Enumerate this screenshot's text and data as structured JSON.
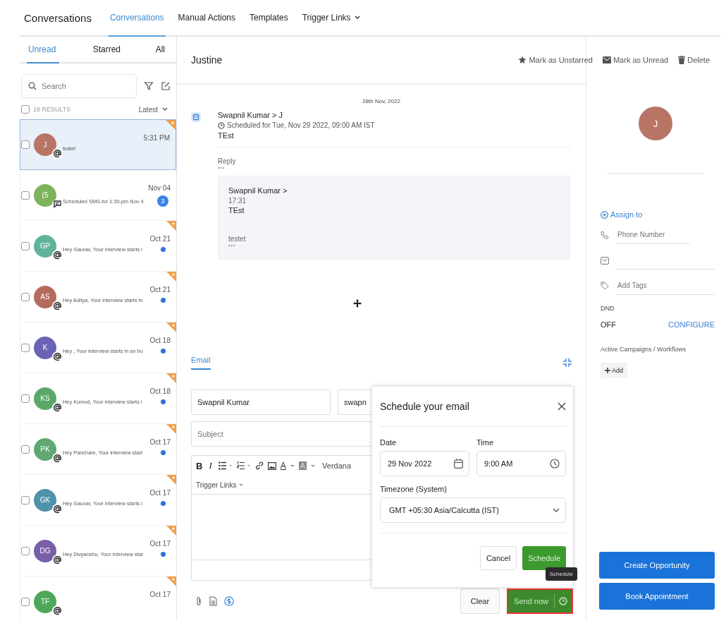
{
  "header": {
    "title": "Conversations",
    "tabs": [
      {
        "label": "Conversations",
        "selected": true,
        "dropdown": false
      },
      {
        "label": "Manual Actions",
        "selected": false,
        "dropdown": false
      },
      {
        "label": "Templates",
        "selected": false,
        "dropdown": false
      },
      {
        "label": "Trigger Links",
        "selected": false,
        "dropdown": true
      }
    ]
  },
  "inbox": {
    "tabs": [
      {
        "label": "Unread",
        "selected": true
      },
      {
        "label": "Starred",
        "selected": false
      },
      {
        "label": "All",
        "selected": false
      }
    ],
    "search": {
      "placeholder": "Search"
    },
    "select_all": {
      "checked": false
    },
    "results": "19 RESULTS",
    "sort": "Latest",
    "conversations": [
      {
        "initials": "J",
        "color": "#b87565",
        "kind": "email",
        "preview": "testet",
        "time": "5:31 PM",
        "selected": true,
        "starred": true,
        "unread": false,
        "checked": false
      },
      {
        "initials": "(5",
        "color": "#7db35a",
        "kind": "sms",
        "preview": "Scheduled SMS-for 1:30-pm Nov 4",
        "time": "Nov 04",
        "badge": "3",
        "selected": false,
        "starred": false,
        "checked": false
      },
      {
        "initials": "GP",
        "color": "#5fb39a",
        "kind": "email",
        "preview": "Hey Gaurav, Your interview starts i",
        "time": "Oct 21",
        "selected": false,
        "starred": true,
        "unread": true,
        "checked": false
      },
      {
        "initials": "AS",
        "color": "#b56a5c",
        "kind": "email",
        "preview": "Hey Aditya, Your interview starts in",
        "time": "Oct 21",
        "selected": false,
        "starred": true,
        "unread": true,
        "checked": false
      },
      {
        "initials": "K",
        "color": "#6b63b5",
        "kind": "email",
        "preview": "Hey , Your interview starts in an ho",
        "time": "Oct 18",
        "selected": false,
        "starred": true,
        "unread": true,
        "checked": false
      },
      {
        "initials": "KS",
        "color": "#5ba86b",
        "kind": "email",
        "preview": "Hey Kumud, Your interview starts i",
        "time": "Oct 18",
        "selected": false,
        "starred": true,
        "unread": true,
        "checked": false
      },
      {
        "initials": "PK",
        "color": "#5fa872",
        "kind": "email",
        "preview": "Hey Pancham, Your interview start",
        "time": "Oct 17",
        "selected": false,
        "starred": true,
        "unread": true,
        "checked": false
      },
      {
        "initials": "GK",
        "color": "#4e93a8",
        "kind": "email",
        "preview": "Hey Gaurav, Your interview starts i",
        "time": "Oct 17",
        "selected": false,
        "starred": true,
        "unread": true,
        "checked": false
      },
      {
        "initials": "DG",
        "color": "#7a5fa8",
        "kind": "email",
        "preview": "Hey Divyanshu, Your interview star",
        "time": "Oct 17",
        "selected": false,
        "starred": true,
        "unread": true,
        "checked": false
      },
      {
        "initials": "TF",
        "color": "#4ea85c",
        "kind": "email",
        "time": "Oct 17",
        "selected": false,
        "starred": true,
        "unread": false,
        "checked": false
      }
    ]
  },
  "conversation": {
    "title": "Justine",
    "actions": [
      {
        "kind": "star",
        "label": "Mark as Unstarred"
      },
      {
        "kind": "mail",
        "label": "Mark as Unread"
      },
      {
        "kind": "trash",
        "label": "Delete"
      }
    ],
    "date": "28th Nov, 2022",
    "message": {
      "sender": "Swapnil Kumar > J",
      "scheduled": "Scheduled for Tue, Nov 29 2022, 09:00 AM IST",
      "body": "TEst",
      "reply": "Reply",
      "more": "•••",
      "quote": {
        "sender": "Swapnil Kumar >",
        "time": "17:31",
        "body": "TEst",
        "text": "testet",
        "more": "•••"
      }
    }
  },
  "composer": {
    "tabs": [
      {
        "label": "Email",
        "selected": true
      }
    ],
    "from_name": "Swapnil Kumar",
    "from_email": "swapn",
    "subject": {
      "placeholder": "Subject"
    },
    "toolbar": [
      {
        "kind": "bold",
        "label": "B"
      },
      {
        "kind": "italic",
        "label": "I"
      },
      {
        "kind": "bullets"
      },
      {
        "kind": "numbers"
      },
      {
        "kind": "link"
      },
      {
        "kind": "image"
      },
      {
        "kind": "color",
        "label": "A"
      },
      {
        "kind": "highlight",
        "label": "A"
      },
      {
        "kind": "font",
        "label": "Verdana"
      }
    ],
    "trigger_links": "Trigger Links",
    "clear": "Clear",
    "send": "Send now",
    "tooltip": "Schedule"
  },
  "schedule": {
    "title": "Schedule your email",
    "date_label": "Date",
    "date": "29 Nov 2022",
    "time_label": "Time",
    "time": "9:00 AM",
    "timezone_label": "Timezone (System)",
    "timezone": "GMT +05:30 Asia/Calcutta (IST)",
    "cancel": "Cancel",
    "submit": "Schedule"
  },
  "contact": {
    "initial": "J",
    "assign": "Assign to",
    "phone": {
      "placeholder": "Phone Number"
    },
    "tags": {
      "placeholder": "Add Tags"
    },
    "dnd_label": "DND",
    "dnd": "OFF",
    "configure": "CONFIGURE",
    "campaigns_label": "Active Campaigns / Workflows",
    "add": "Add",
    "buttons": [
      "Create Opportunity",
      "Book Appointment"
    ]
  }
}
